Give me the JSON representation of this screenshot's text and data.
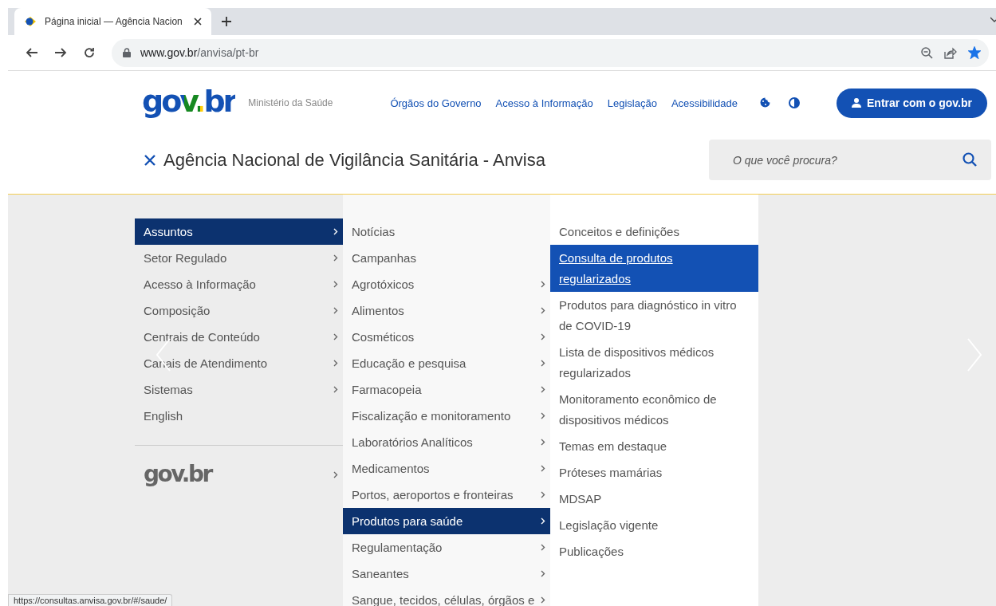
{
  "browser": {
    "tabs": [
      {
        "title": "Página inicial — Agência Nacion",
        "selected": true
      }
    ],
    "url_host": "www.gov.br",
    "url_path": "/anvisa/pt-br",
    "bookmarked": true
  },
  "header": {
    "logo": "gov.br",
    "ministry": "Ministério da Saúde",
    "links": [
      "Órgãos do Governo",
      "Acesso à Informação",
      "Legislação",
      "Acessibilidade"
    ],
    "login_button": "Entrar com o gov.br",
    "site_title": "Agência Nacional de Vigilância Sanitária - Anvisa",
    "search": {
      "placeholder": "O que você procura?"
    }
  },
  "menu": {
    "columns": [
      {
        "items": [
          {
            "label": "Assuntos",
            "has_submenu": true,
            "selected": true
          },
          {
            "label": "Setor Regulado",
            "has_submenu": true,
            "selected": false
          },
          {
            "label": "Acesso à Informação",
            "has_submenu": true,
            "selected": false
          },
          {
            "label": "Composição",
            "has_submenu": true,
            "selected": false
          },
          {
            "label": "Centrais de Conteúdo",
            "has_submenu": true,
            "selected": false
          },
          {
            "label": "Canais de Atendimento",
            "has_submenu": true,
            "selected": false
          },
          {
            "label": "Sistemas",
            "has_submenu": true,
            "selected": false
          },
          {
            "label": "English",
            "has_submenu": false,
            "selected": false
          }
        ]
      },
      {
        "items": [
          {
            "label": "Notícias",
            "has_submenu": false,
            "selected": false
          },
          {
            "label": "Campanhas",
            "has_submenu": false,
            "selected": false
          },
          {
            "label": "Agrotóxicos",
            "has_submenu": true,
            "selected": false
          },
          {
            "label": "Alimentos",
            "has_submenu": true,
            "selected": false
          },
          {
            "label": "Cosméticos",
            "has_submenu": true,
            "selected": false
          },
          {
            "label": "Educação e pesquisa",
            "has_submenu": true,
            "selected": false
          },
          {
            "label": "Farmacopeia",
            "has_submenu": true,
            "selected": false
          },
          {
            "label": "Fiscalização e monitoramento",
            "has_submenu": true,
            "selected": false
          },
          {
            "label": "Laboratórios Analíticos",
            "has_submenu": true,
            "selected": false
          },
          {
            "label": "Medicamentos",
            "has_submenu": true,
            "selected": false
          },
          {
            "label": "Portos, aeroportos e fronteiras",
            "has_submenu": true,
            "selected": false
          },
          {
            "label": "Produtos para saúde",
            "has_submenu": true,
            "selected": true
          },
          {
            "label": "Regulamentação",
            "has_submenu": true,
            "selected": false
          },
          {
            "label": "Saneantes",
            "has_submenu": true,
            "selected": false
          },
          {
            "label": "Sangue, tecidos, células, órgãos e",
            "has_submenu": true,
            "selected": false
          }
        ]
      },
      {
        "items": [
          {
            "label": "Conceitos e definições",
            "selected": false
          },
          {
            "label": "Consulta de produtos regularizados",
            "selected": true
          },
          {
            "label": "Produtos para diagnóstico in vitro de COVID-19",
            "selected": false
          },
          {
            "label": "Lista de dispositivos médicos regularizados",
            "selected": false
          },
          {
            "label": "Monitoramento econômico de dispositivos médicos",
            "selected": false
          },
          {
            "label": "Temas em destaque",
            "selected": false
          },
          {
            "label": "Próteses mamárias",
            "selected": false
          },
          {
            "label": "MDSAP",
            "selected": false
          },
          {
            "label": "Legislação vigente",
            "selected": false
          },
          {
            "label": "Publicações",
            "selected": false
          }
        ]
      }
    ],
    "footer_logo": {
      "text": "gov.br",
      "has_submenu": true
    }
  },
  "status_bar": "https://consultas.anvisa.gov.br/#/saude/"
}
